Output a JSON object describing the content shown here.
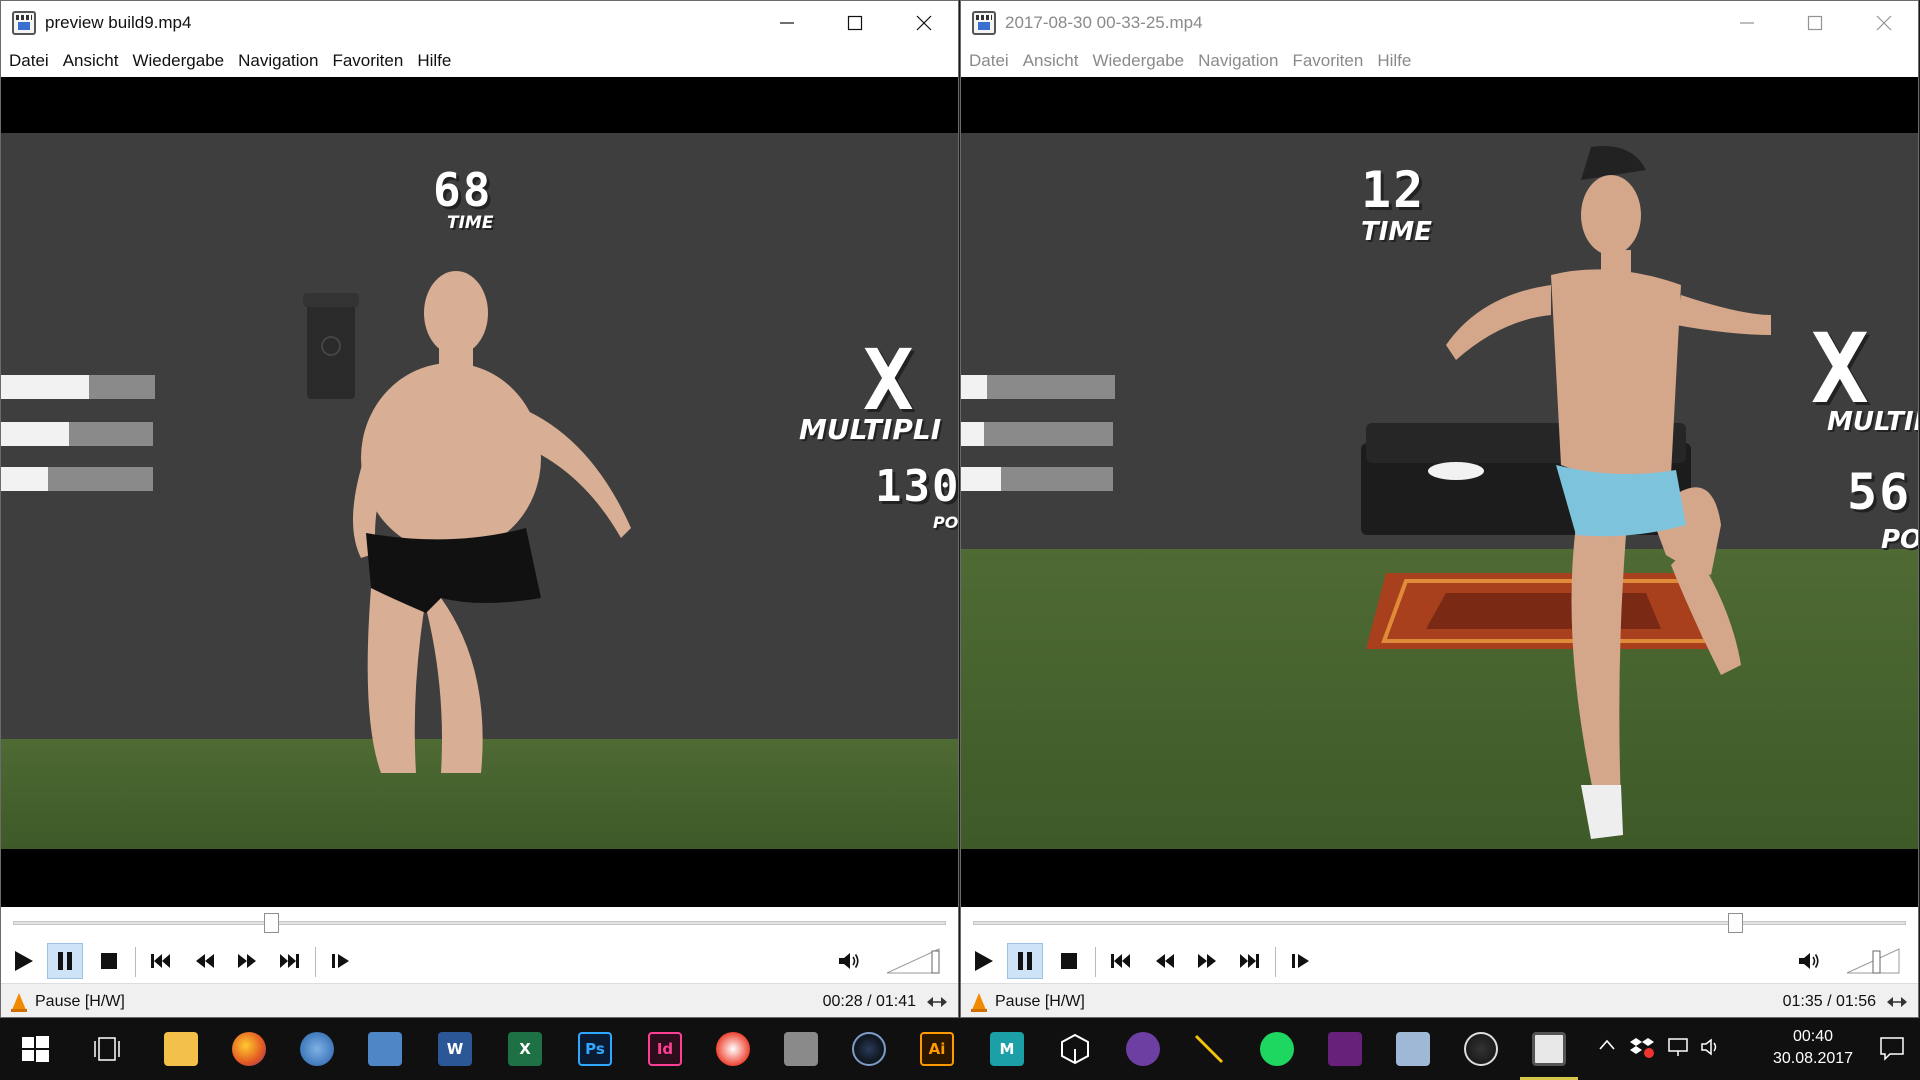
{
  "window_controls": {
    "minimize": "minimize-icon",
    "maximize": "maximize-icon",
    "close": "close-icon"
  },
  "menu_items": [
    "Datei",
    "Ansicht",
    "Wiedergabe",
    "Navigation",
    "Favoriten",
    "Hilfe"
  ],
  "left_player": {
    "title": "preview build9.mp4",
    "status": "Pause [H/W]",
    "time": "00:28 / 01:41",
    "seek_fraction": 0.277,
    "hud": {
      "time_value": "68",
      "time_label": "TIME",
      "multiplier_symbol": "X",
      "multiplier_label": "MULTIPLI",
      "points_value": "130",
      "points_label": "PO"
    },
    "bar_fills": [
      0.57,
      0.45,
      0.31
    ]
  },
  "right_player": {
    "title": "2017-08-30 00-33-25.mp4",
    "status": "Pause [H/W]",
    "time": "01:35 / 01:56",
    "seek_fraction": 0.819,
    "hud": {
      "time_value": "12",
      "time_label": "TIME",
      "multiplier_symbol": "X",
      "multiplier_label": "MULTIP",
      "points_value": "56",
      "points_label": "PO"
    },
    "bar_fills": [
      0.17,
      0.15,
      0.26
    ]
  },
  "taskbar": {
    "icons": [
      "windows-start-icon",
      "task-view-icon",
      "file-explorer-icon",
      "firefox-icon",
      "thunderbird-icon",
      "remote-desktop-icon",
      "word-icon",
      "excel-icon",
      "photoshop-icon",
      "indesign-icon",
      "paint-icon",
      "blank-app-icon",
      "cinema4d-icon",
      "illustrator-icon",
      "maya-icon",
      "unity-icon",
      "github-icon",
      "pen-tool-icon",
      "spotify-icon",
      "visual-studio-icon",
      "image-app-icon",
      "obs-icon",
      "media-player-classic-icon"
    ],
    "icon_labels": {
      "word": "W",
      "excel": "X",
      "photoshop": "Ps",
      "indesign": "Id",
      "illustrator": "Ai",
      "maya": "M"
    },
    "clock_time": "00:40",
    "clock_date": "30.08.2017"
  },
  "colors": {
    "accent": "#76b9ed",
    "hud_text": "#ffffff",
    "wall": "#3e3e3e",
    "floor": "#4f6a33",
    "bar_fill": "#f2f2f2",
    "bar_track": "#8a8a8a"
  }
}
